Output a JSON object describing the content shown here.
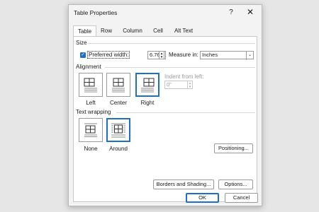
{
  "dialog": {
    "title": "Table Properties",
    "help_glyph": "?",
    "close_glyph": "✕"
  },
  "tabs": [
    {
      "label": "Table",
      "active": true
    },
    {
      "label": "Row",
      "active": false
    },
    {
      "label": "Column",
      "active": false
    },
    {
      "label": "Cell",
      "active": false
    },
    {
      "label": "Alt Text",
      "active": false
    }
  ],
  "size": {
    "section_label": "Size",
    "preferred_width_label": "Preferred width:",
    "preferred_width_checked": true,
    "preferred_width_value": "6.76\"",
    "measure_in_label": "Measure in:",
    "measure_in_value": "Inches"
  },
  "alignment": {
    "section_label": "Alignment",
    "options": [
      {
        "label": "Left",
        "selected": false
      },
      {
        "label": "Center",
        "selected": false
      },
      {
        "label": "Right",
        "selected": true
      }
    ],
    "indent_label": "Indent from left:",
    "indent_value": "0\""
  },
  "text_wrapping": {
    "section_label": "Text wrapping",
    "options": [
      {
        "label": "None",
        "selected": false
      },
      {
        "label": "Around",
        "selected": true
      }
    ],
    "positioning_label": "Positioning..."
  },
  "buttons": {
    "borders_label": "Borders and Shading...",
    "options_label": "Options...",
    "ok_label": "OK",
    "cancel_label": "Cancel"
  },
  "colors": {
    "accent": "#1f6fc5"
  }
}
